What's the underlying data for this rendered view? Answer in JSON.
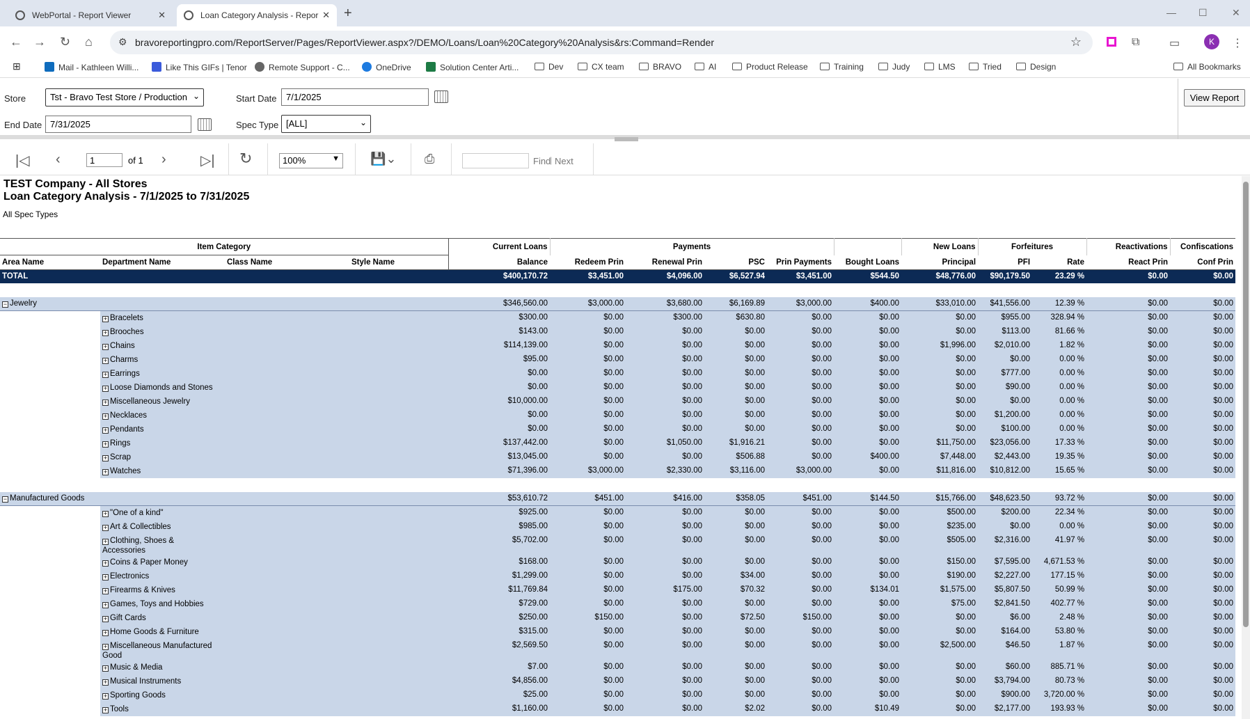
{
  "browser": {
    "tabs": [
      {
        "title": "WebPortal - Report Viewer"
      },
      {
        "title": "Loan Category Analysis - Repor"
      }
    ],
    "url": "bravoreportingpro.com/ReportServer/Pages/ReportViewer.aspx?/DEMO/Loans/Loan%20Category%20Analysis&rs:Command=Render",
    "avatar_letter": "K",
    "bookmarks": [
      "Mail - Kathleen Willi...",
      "Like This GIFs | Tenor",
      "Remote Support - C...",
      "OneDrive",
      "Solution Center Arti...",
      "Dev",
      "CX team",
      "BRAVO",
      "AI",
      "Product Release",
      "Training",
      "Judy",
      "LMS",
      "Tried",
      "Design",
      "All Bookmarks"
    ]
  },
  "params": {
    "store_label": "Store",
    "store_value": "Tst - Bravo Test Store / Production",
    "start_date_label": "Start Date",
    "start_date_value": "7/1/2025",
    "end_date_label": "End Date",
    "end_date_value": "7/31/2025",
    "spec_type_label": "Spec Type",
    "spec_type_value": "[ALL]",
    "view_report_label": "View Report"
  },
  "toolbar": {
    "page_value": "1",
    "page_of": "of 1",
    "zoom_value": "100%",
    "find_label": "Find",
    "next_label": "Next"
  },
  "report": {
    "title1": "TEST Company - All Stores",
    "title2": "Loan Category Analysis - 7/1/2025 to 7/31/2025",
    "subtitle": "All Spec Types",
    "group_headers": [
      "Item Category",
      "Current Loans",
      "Payments",
      "New Loans",
      "Forfeitures",
      "Reactivations",
      "Confiscations"
    ],
    "col_headers": [
      "Area Name",
      "Department Name",
      "Class Name",
      "Style Name",
      "Balance",
      "Redeem Prin",
      "Renewal Prin",
      "PSC",
      "Prin Payments",
      "Bought Loans",
      "Principal",
      "PFI",
      "Rate",
      "React Prin",
      "Conf Prin"
    ],
    "total": {
      "label": "TOTAL",
      "values": [
        "$400,170.72",
        "$3,451.00",
        "$4,096.00",
        "$6,527.94",
        "$3,451.00",
        "$544.50",
        "$48,776.00",
        "$90,179.50",
        "23.29 %",
        "$0.00",
        "$0.00"
      ]
    },
    "categories": [
      {
        "name": "Jewelry",
        "values": [
          "$346,560.00",
          "$3,000.00",
          "$3,680.00",
          "$6,169.89",
          "$3,000.00",
          "$400.00",
          "$33,010.00",
          "$41,556.00",
          "12.39 %",
          "$0.00",
          "$0.00"
        ],
        "rows": [
          {
            "name": "Bracelets",
            "values": [
              "$300.00",
              "$0.00",
              "$300.00",
              "$630.80",
              "$0.00",
              "$0.00",
              "$0.00",
              "$955.00",
              "328.94 %",
              "$0.00",
              "$0.00"
            ]
          },
          {
            "name": "Brooches",
            "values": [
              "$143.00",
              "$0.00",
              "$0.00",
              "$0.00",
              "$0.00",
              "$0.00",
              "$0.00",
              "$113.00",
              "81.66 %",
              "$0.00",
              "$0.00"
            ]
          },
          {
            "name": "Chains",
            "values": [
              "$114,139.00",
              "$0.00",
              "$0.00",
              "$0.00",
              "$0.00",
              "$0.00",
              "$1,996.00",
              "$2,010.00",
              "1.82 %",
              "$0.00",
              "$0.00"
            ]
          },
          {
            "name": "Charms",
            "values": [
              "$95.00",
              "$0.00",
              "$0.00",
              "$0.00",
              "$0.00",
              "$0.00",
              "$0.00",
              "$0.00",
              "0.00 %",
              "$0.00",
              "$0.00"
            ]
          },
          {
            "name": "Earrings",
            "values": [
              "$0.00",
              "$0.00",
              "$0.00",
              "$0.00",
              "$0.00",
              "$0.00",
              "$0.00",
              "$777.00",
              "0.00 %",
              "$0.00",
              "$0.00"
            ]
          },
          {
            "name": "Loose Diamonds and Stones",
            "values": [
              "$0.00",
              "$0.00",
              "$0.00",
              "$0.00",
              "$0.00",
              "$0.00",
              "$0.00",
              "$90.00",
              "0.00 %",
              "$0.00",
              "$0.00"
            ]
          },
          {
            "name": "Miscellaneous Jewelry",
            "values": [
              "$10,000.00",
              "$0.00",
              "$0.00",
              "$0.00",
              "$0.00",
              "$0.00",
              "$0.00",
              "$0.00",
              "0.00 %",
              "$0.00",
              "$0.00"
            ]
          },
          {
            "name": "Necklaces",
            "values": [
              "$0.00",
              "$0.00",
              "$0.00",
              "$0.00",
              "$0.00",
              "$0.00",
              "$0.00",
              "$1,200.00",
              "0.00 %",
              "$0.00",
              "$0.00"
            ]
          },
          {
            "name": "Pendants",
            "values": [
              "$0.00",
              "$0.00",
              "$0.00",
              "$0.00",
              "$0.00",
              "$0.00",
              "$0.00",
              "$100.00",
              "0.00 %",
              "$0.00",
              "$0.00"
            ]
          },
          {
            "name": "Rings",
            "values": [
              "$137,442.00",
              "$0.00",
              "$1,050.00",
              "$1,916.21",
              "$0.00",
              "$0.00",
              "$11,750.00",
              "$23,056.00",
              "17.33 %",
              "$0.00",
              "$0.00"
            ]
          },
          {
            "name": "Scrap",
            "values": [
              "$13,045.00",
              "$0.00",
              "$0.00",
              "$506.88",
              "$0.00",
              "$400.00",
              "$7,448.00",
              "$2,443.00",
              "19.35 %",
              "$0.00",
              "$0.00"
            ]
          },
          {
            "name": "Watches",
            "values": [
              "$71,396.00",
              "$3,000.00",
              "$2,330.00",
              "$3,116.00",
              "$3,000.00",
              "$0.00",
              "$11,816.00",
              "$10,812.00",
              "15.65 %",
              "$0.00",
              "$0.00"
            ]
          }
        ]
      },
      {
        "name": "Manufactured Goods",
        "values": [
          "$53,610.72",
          "$451.00",
          "$416.00",
          "$358.05",
          "$451.00",
          "$144.50",
          "$15,766.00",
          "$48,623.50",
          "93.72 %",
          "$0.00",
          "$0.00"
        ],
        "rows": [
          {
            "name": "\"One of a kind\"",
            "values": [
              "$925.00",
              "$0.00",
              "$0.00",
              "$0.00",
              "$0.00",
              "$0.00",
              "$500.00",
              "$200.00",
              "22.34 %",
              "$0.00",
              "$0.00"
            ]
          },
          {
            "name": "Art & Collectibles",
            "values": [
              "$985.00",
              "$0.00",
              "$0.00",
              "$0.00",
              "$0.00",
              "$0.00",
              "$235.00",
              "$0.00",
              "0.00 %",
              "$0.00",
              "$0.00"
            ]
          },
          {
            "name": "Clothing, Shoes & Accessories",
            "values": [
              "$5,702.00",
              "$0.00",
              "$0.00",
              "$0.00",
              "$0.00",
              "$0.00",
              "$505.00",
              "$2,316.00",
              "41.97 %",
              "$0.00",
              "$0.00"
            ]
          },
          {
            "name": "Coins & Paper Money",
            "values": [
              "$168.00",
              "$0.00",
              "$0.00",
              "$0.00",
              "$0.00",
              "$0.00",
              "$150.00",
              "$7,595.00",
              "4,671.53 %",
              "$0.00",
              "$0.00"
            ]
          },
          {
            "name": "Electronics",
            "values": [
              "$1,299.00",
              "$0.00",
              "$0.00",
              "$34.00",
              "$0.00",
              "$0.00",
              "$190.00",
              "$2,227.00",
              "177.15 %",
              "$0.00",
              "$0.00"
            ]
          },
          {
            "name": "Firearms & Knives",
            "values": [
              "$11,769.84",
              "$0.00",
              "$175.00",
              "$70.32",
              "$0.00",
              "$134.01",
              "$1,575.00",
              "$5,807.50",
              "50.99 %",
              "$0.00",
              "$0.00"
            ]
          },
          {
            "name": "Games, Toys and Hobbies",
            "values": [
              "$729.00",
              "$0.00",
              "$0.00",
              "$0.00",
              "$0.00",
              "$0.00",
              "$75.00",
              "$2,841.50",
              "402.77 %",
              "$0.00",
              "$0.00"
            ]
          },
          {
            "name": "Gift Cards",
            "values": [
              "$250.00",
              "$150.00",
              "$0.00",
              "$72.50",
              "$150.00",
              "$0.00",
              "$0.00",
              "$6.00",
              "2.48 %",
              "$0.00",
              "$0.00"
            ]
          },
          {
            "name": "Home Goods & Furniture",
            "values": [
              "$315.00",
              "$0.00",
              "$0.00",
              "$0.00",
              "$0.00",
              "$0.00",
              "$0.00",
              "$164.00",
              "53.80 %",
              "$0.00",
              "$0.00"
            ]
          },
          {
            "name": "Miscellaneous Manufactured Good",
            "values": [
              "$2,569.50",
              "$0.00",
              "$0.00",
              "$0.00",
              "$0.00",
              "$0.00",
              "$2,500.00",
              "$46.50",
              "1.87 %",
              "$0.00",
              "$0.00"
            ]
          },
          {
            "name": "Music & Media",
            "values": [
              "$7.00",
              "$0.00",
              "$0.00",
              "$0.00",
              "$0.00",
              "$0.00",
              "$0.00",
              "$60.00",
              "885.71 %",
              "$0.00",
              "$0.00"
            ]
          },
          {
            "name": "Musical Instruments",
            "values": [
              "$4,856.00",
              "$0.00",
              "$0.00",
              "$0.00",
              "$0.00",
              "$0.00",
              "$0.00",
              "$3,794.00",
              "80.73 %",
              "$0.00",
              "$0.00"
            ]
          },
          {
            "name": "Sporting Goods",
            "values": [
              "$25.00",
              "$0.00",
              "$0.00",
              "$0.00",
              "$0.00",
              "$0.00",
              "$0.00",
              "$900.00",
              "3,720.00 %",
              "$0.00",
              "$0.00"
            ]
          },
          {
            "name": "Tools",
            "values": [
              "$1,160.00",
              "$0.00",
              "$0.00",
              "$2.02",
              "$0.00",
              "$10.49",
              "$0.00",
              "$2,177.00",
              "193.93 %",
              "$0.00",
              "$0.00"
            ]
          }
        ]
      }
    ]
  }
}
